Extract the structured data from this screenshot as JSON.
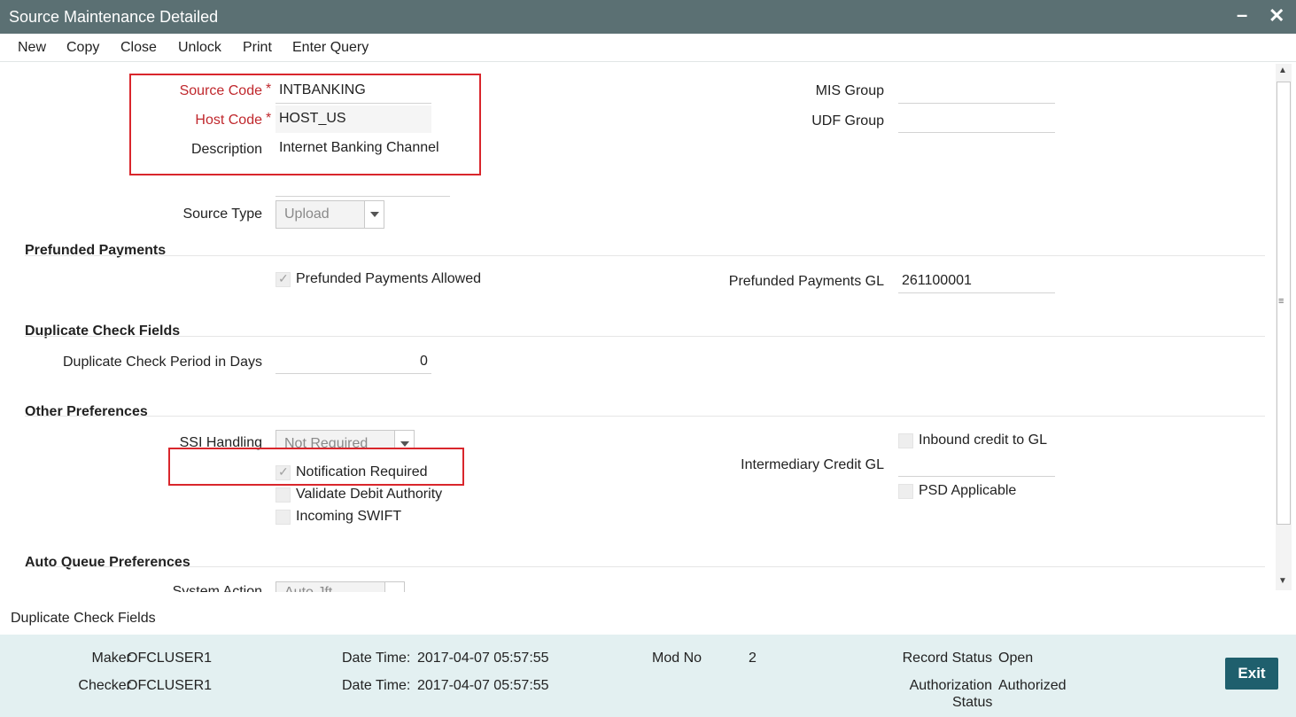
{
  "window": {
    "title": "Source Maintenance Detailed",
    "minimize": "–",
    "close": "✕"
  },
  "toolbar": {
    "new": "New",
    "copy": "Copy",
    "close": "Close",
    "unlock": "Unlock",
    "print": "Print",
    "enter_query": "Enter Query"
  },
  "form": {
    "source_code_label": "Source Code",
    "source_code_value": "INTBANKING",
    "host_code_label": "Host Code",
    "host_code_value": "HOST_US",
    "description_label": "Description",
    "description_value": "Internet Banking Channel",
    "mis_group_label": "MIS Group",
    "mis_group_value": "",
    "udf_group_label": "UDF Group",
    "udf_group_value": "",
    "source_type_label": "Source Type",
    "source_type_value": "Upload",
    "required_mark": "*"
  },
  "prefunded": {
    "section": "Prefunded Payments",
    "allowed_label": "Prefunded Payments Allowed",
    "allowed_checked": true,
    "gl_label": "Prefunded Payments GL",
    "gl_value": "261100001"
  },
  "duplicate": {
    "section": "Duplicate Check Fields",
    "period_label": "Duplicate Check Period in Days",
    "period_value": "0"
  },
  "other": {
    "section": "Other Preferences",
    "ssi_label": "SSI Handling",
    "ssi_value": "Not Required",
    "notification_label": "Notification Required",
    "notification_checked": true,
    "validate_debit_label": "Validate Debit Authority",
    "validate_debit_checked": false,
    "incoming_swift_label": "Incoming SWIFT",
    "incoming_swift_checked": false,
    "inbound_credit_label": "Inbound credit to GL",
    "inbound_credit_checked": false,
    "intermediary_label": "Intermediary Credit GL",
    "intermediary_value": "",
    "psd_label": "PSD Applicable",
    "psd_checked": false
  },
  "auto_queue": {
    "section": "Auto Queue Preferences",
    "system_action_label": "System Action",
    "system_action_value": "Auto Jft"
  },
  "status_tab": "Duplicate Check Fields",
  "footer": {
    "maker_label": "Maker",
    "maker_value": "OFCLUSER1",
    "checker_label": "Checker",
    "checker_value": "OFCLUSER1",
    "date_time_label": "Date Time:",
    "maker_date": "2017-04-07 05:57:55",
    "checker_date": "2017-04-07 05:57:55",
    "mod_no_label": "Mod No",
    "mod_no_value": "2",
    "record_status_label": "Record Status",
    "record_status_value": "Open",
    "auth_status_label_1": "Authorization",
    "auth_status_label_2": "Status",
    "auth_status_value": "Authorized",
    "exit_label": "Exit"
  },
  "colors": {
    "titlebar": "#5b7073",
    "required": "#c0282d",
    "highlight_box": "#d9262c",
    "footer_bg": "#e3f0f1",
    "exit_button": "#1f5f6d"
  }
}
